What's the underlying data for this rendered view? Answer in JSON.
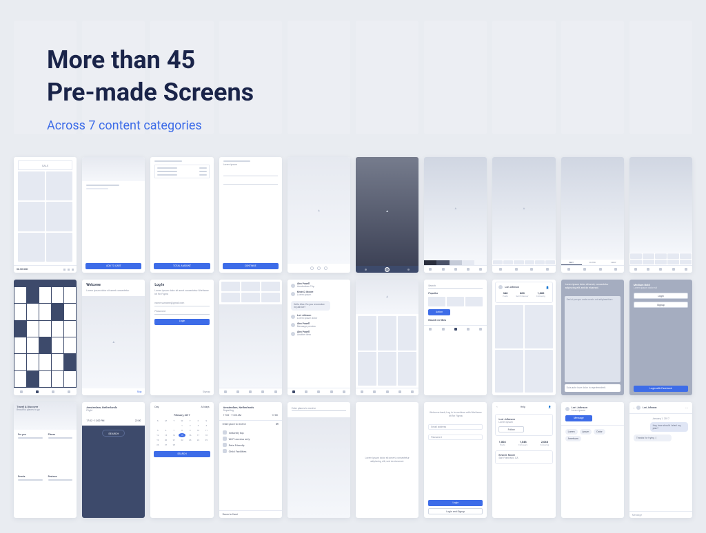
{
  "header": {
    "title_line1": "More than 45",
    "title_line2": "Pre-made Screens",
    "subtitle": "Across 7 content categories"
  },
  "cards": {
    "sale": "SALE",
    "price": "$8.50 USD",
    "add_cart": "ADD TO CART",
    "total_amount": "TOTAL AMOUNT",
    "continue": "CONTINUE",
    "welcome": "Welcome",
    "welcome_sub": "Lorem ipsum dolor sit amet consectetur",
    "login": "Log In",
    "login_sub": "Lorem ipsum dolor sit amet consectetur Wreframe kit for Figma",
    "email": "name.surname@gmail.com",
    "password": "Password",
    "login_btn": "Login",
    "signup": "Signup",
    "alex": "Alex Powell",
    "alex_loc": "Amsterdam Trip",
    "kevin": "Kevin D. Moore",
    "kevin_msg": "Lorem ipsum",
    "lori": "Lori Johnson",
    "chat1": "Hello Alex. Do you remember my advice?",
    "search": "Search",
    "popular": "Popular",
    "based": "Based on likes",
    "stats_posts": "Posts",
    "stats_followers": "Set Professor",
    "stats_following": "Following",
    "stats_n1": "348",
    "stats_n2": "800",
    "stats_n3": "1,800",
    "lorem1": "Lorem ipsum dolor sit amet, consectetur adipiscing elit, sed do eiusmod.",
    "medium_bold": "Medium Bold",
    "sed_based": "Sed ut persps unde omnis vol adipisantium.",
    "duis": "Duis aute irure dolor in reprehenderit.",
    "login_fb": "Login with Facebook",
    "travel": "Travel & Discover",
    "for_you": "For you",
    "places": "Places",
    "events": "Events",
    "reviews": "Reviews",
    "amsterdam": "Amsterdam, Netherlands",
    "time1": "17:02 - 12:00 PM",
    "time2": "22:00",
    "time3": "17:02 - 11:00 AM",
    "time4": "17:00",
    "search_btn": "SEARCH",
    "day": "Day",
    "alldays": "All days",
    "february": "February, 2017",
    "entire": "Entire place to receive",
    "entire59": "59",
    "instant": "Instantly top",
    "wifi": "Wi-Fi access only",
    "pets": "Pets Friendly",
    "child": "Child Facilities",
    "room_cami": "Room to Cami",
    "lorem_center": "Lorem ipsum dolor sit amert, consectetur adipiscing elit, sed do eiusmod.",
    "welcome_back": "Welcome back, Log in to continue with Wreframe kit for Figma",
    "email_ph": "Email address",
    "login_signup": "Login and Signup",
    "help": "Help",
    "follow": "Follow",
    "posts_n": "1,804",
    "followers_n": "1,548",
    "following_n": "2,048",
    "kevid": "Kevin D. Moore",
    "san": "San Francisco, CA",
    "message": "Message",
    "jan": "January 1, 2017",
    "chat_msg1": "Hey, how should I start my plan?",
    "chat_msg2": "Thanks for trying :)"
  }
}
